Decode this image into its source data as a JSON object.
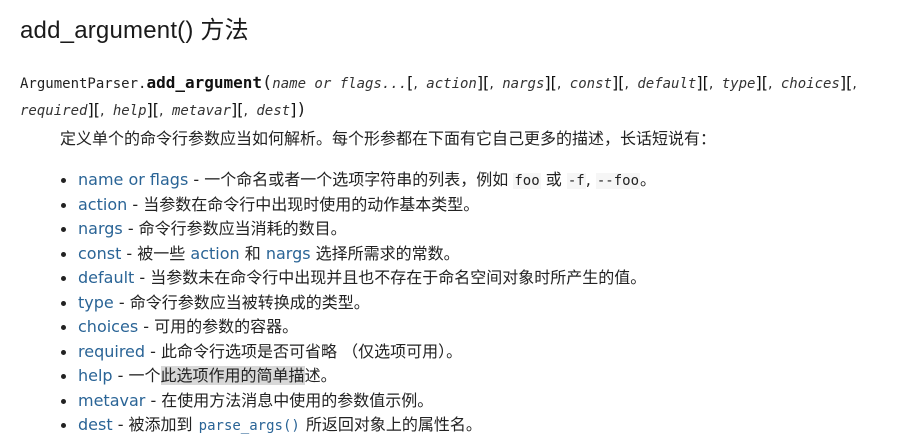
{
  "title": "add_argument() 方法",
  "signature": {
    "class_name": "ArgumentParser.",
    "method_name": "add_argument",
    "open_paren": "(",
    "close_paren": ")",
    "first_param": "name or flags...",
    "params": [
      "action",
      "nargs",
      "const",
      "default",
      "type",
      "choices",
      "required",
      "help",
      "metavar",
      "dest"
    ],
    "open_bracket": "[",
    "close_bracket": "]",
    "comma": ","
  },
  "description": "定义单个的命令行参数应当如何解析。每个形参都在下面有它自己更多的描述，长话短说有：",
  "items": [
    {
      "name": "name or flags",
      "parts": [
        " - 一个命名或者一个选项字符串的列表，例如 ",
        "foo",
        " 或 ",
        "-f",
        ", ",
        "--foo",
        "。"
      ]
    },
    {
      "name": "action",
      "text": " - 当参数在命令行中出现时使用的动作基本类型。"
    },
    {
      "name": "nargs",
      "text": " - 命令行参数应当消耗的数目。"
    },
    {
      "name": "const",
      "parts": [
        " - 被一些 ",
        "action",
        " 和 ",
        "nargs",
        " 选择所需求的常数。"
      ]
    },
    {
      "name": "default",
      "text": " - 当参数未在命令行中出现并且也不存在于命名空间对象时所产生的值。"
    },
    {
      "name": "type",
      "text": " - 命令行参数应当被转换成的类型。"
    },
    {
      "name": "choices",
      "text": " - 可用的参数的容器。"
    },
    {
      "name": "required",
      "text": " - 此命令行选项是否可省略 （仅选项可用）。"
    },
    {
      "name": "help",
      "parts": [
        " - 一个",
        "此选项作用的简单描",
        "述。"
      ]
    },
    {
      "name": "metavar",
      "text": " - 在使用方法消息中使用的参数值示例。"
    },
    {
      "name": "dest",
      "parts": [
        " - 被添加到 ",
        "parse_args()",
        " 所返回对象上的属性名。"
      ]
    }
  ]
}
